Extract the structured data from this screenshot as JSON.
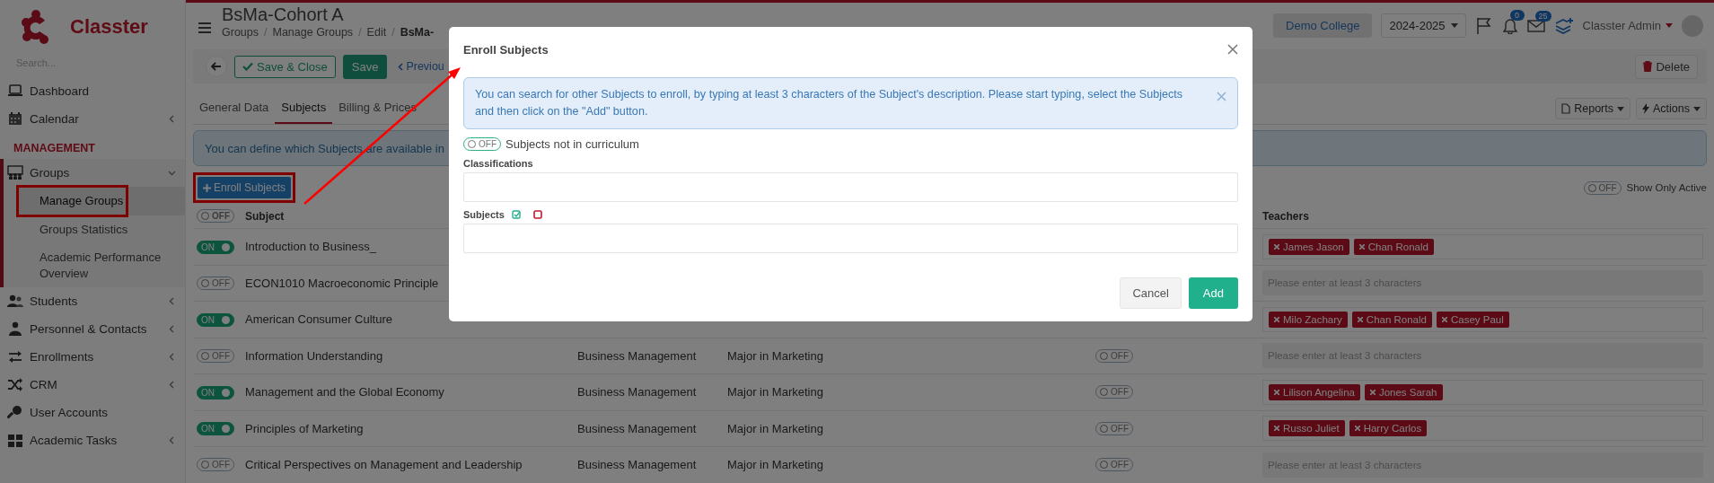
{
  "sidebar": {
    "brand": "Classter",
    "search_placeholder": "Search...",
    "items": [
      {
        "kind": "item",
        "label": "Dashboard"
      },
      {
        "kind": "item",
        "label": "Calendar",
        "expanded": false
      },
      {
        "kind": "section",
        "label": "MANAGEMENT"
      },
      {
        "kind": "item",
        "label": "Groups",
        "expanded": true,
        "children": [
          {
            "label": "Manage Groups",
            "selected": true
          },
          {
            "label": "Groups Statistics",
            "selected": false
          },
          {
            "label": "Academic Performance Overview",
            "selected": false
          }
        ]
      },
      {
        "kind": "item",
        "label": "Students",
        "expanded": false
      },
      {
        "kind": "item",
        "label": "Personnel & Contacts",
        "expanded": false
      },
      {
        "kind": "item",
        "label": "Enrollments",
        "expanded": false
      },
      {
        "kind": "item",
        "label": "CRM",
        "expanded": false
      },
      {
        "kind": "item",
        "label": "User Accounts"
      },
      {
        "kind": "item",
        "label": "Academic Tasks",
        "expanded": false
      }
    ]
  },
  "header": {
    "title": "BsMa-Cohort A",
    "breadcrumb": [
      {
        "label": "Groups",
        "separator": "/"
      },
      {
        "label": "Manage Groups",
        "separator": "/"
      },
      {
        "label": "Edit",
        "separator": "/"
      },
      {
        "label": "BsMa-"
      }
    ],
    "institution": "Demo College",
    "year": "2024-2025",
    "notifications": "0",
    "messages": "25",
    "user": "Classter Admin"
  },
  "toolbar": {
    "save_close": "Save & Close",
    "save": "Save",
    "previous": "Previou",
    "delete": "Delete"
  },
  "tabs": [
    {
      "label": "General Data",
      "selected": false
    },
    {
      "label": "Subjects",
      "selected": true
    },
    {
      "label": "Billing & Prices",
      "selected": false
    }
  ],
  "menus": {
    "reports": "Reports",
    "actions": "Actions"
  },
  "info_banner": "You can define which Subjects are available in",
  "enroll_button": "Enroll Subjects",
  "show_only_active": {
    "toggle": {
      "on": false,
      "label": "OFF"
    },
    "label": "Show Only Active"
  },
  "table": {
    "header_toggle": {
      "on": false,
      "label": "OFF"
    },
    "columns": [
      "Subject",
      "Teachers"
    ],
    "rows": [
      {
        "toggle": {
          "on": true,
          "label": "ON"
        },
        "subject": "Introduction to Business_",
        "teachers": [
          "James Jason",
          "Chan Ronald"
        ]
      },
      {
        "toggle": {
          "on": false,
          "label": "OFF"
        },
        "subject": "ECON1010 Macroeconomic Principle",
        "teachers": [],
        "teachers_placeholder": "Please enter at least 3 characters"
      },
      {
        "toggle": {
          "on": true,
          "label": "ON"
        },
        "subject": "American Consumer Culture",
        "teachers": [
          "Milo Zachary",
          "Chan Ronald",
          "Casey Paul"
        ]
      },
      {
        "toggle": {
          "on": false,
          "label": "OFF"
        },
        "subject": "Information Understanding",
        "classification": "Business Management",
        "major": "Major in Marketing",
        "active": {
          "on": false,
          "label": "OFF"
        },
        "teachers": [],
        "teachers_placeholder": "Please enter at least 3 characters"
      },
      {
        "toggle": {
          "on": true,
          "label": "ON"
        },
        "subject": "Management and the Global Economy",
        "classification": "Business Management",
        "major": "Major in Marketing",
        "active": {
          "on": false,
          "label": "OFF"
        },
        "teachers": [
          "Lilison Angelina",
          "Jones Sarah"
        ]
      },
      {
        "toggle": {
          "on": true,
          "label": "ON"
        },
        "subject": "Principles of Marketing",
        "classification": "Business Management",
        "major": "Major in Marketing",
        "active": {
          "on": false,
          "label": "OFF"
        },
        "teachers": [
          "Russo Juliet",
          "Harry Carlos"
        ]
      },
      {
        "toggle": {
          "on": false,
          "label": "OFF"
        },
        "subject": "Critical Perspectives on Management and Leadership",
        "classification": "Business Management",
        "major": "Major in Marketing",
        "active": {
          "on": false,
          "label": "OFF"
        },
        "teachers": [],
        "teachers_placeholder": "Please enter at least 3 characters"
      }
    ]
  },
  "modal": {
    "title": "Enroll Subjects",
    "alert": "You can search for other Subjects to enroll, by typing at least 3 characters of the Subject's description. Please start typing, select the Subjects and then click on the \"Add\" button.",
    "curriculum_toggle": {
      "on": false,
      "label": "OFF"
    },
    "curriculum_label": "Subjects not in curriculum",
    "classifications_label": "Classifications",
    "subjects_label": "Subjects",
    "cancel": "Cancel",
    "add": "Add"
  }
}
